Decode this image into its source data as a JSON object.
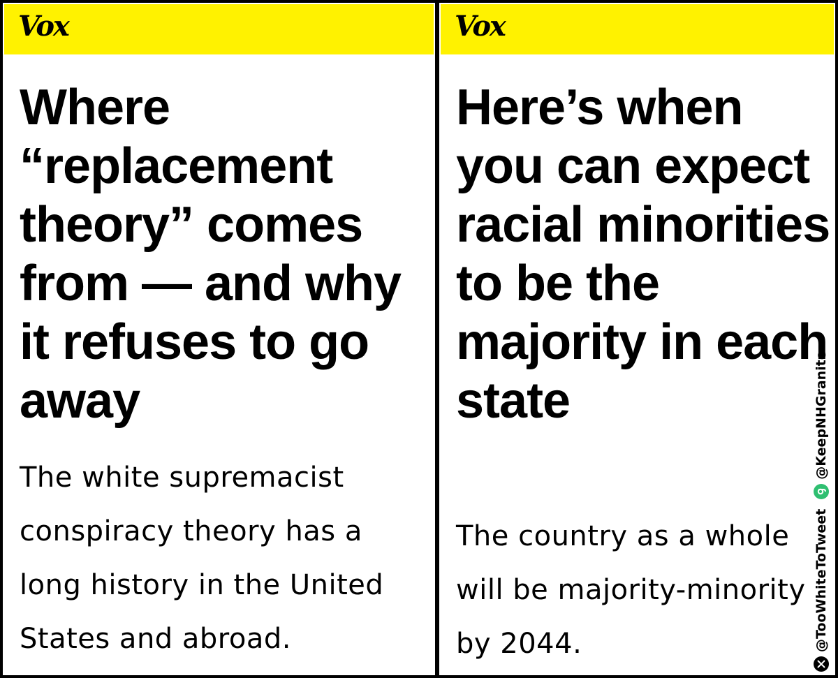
{
  "left_card": {
    "brand": "Vox",
    "headline": "Where “replacement theory” comes from — and why it refuses to go away",
    "dek": "The white supremacist conspiracy theory has a long history in the United States and abroad."
  },
  "right_card": {
    "brand": "Vox",
    "headline": "Here’s when you can expect racial minorities to be the majority in each state",
    "dek": "The country as a whole will be majority-minority by 2044."
  },
  "watermark": {
    "x_handle": "@TooWhiteToTweet",
    "gab_handle": "@KeepNHGranite",
    "icons": [
      "x-logo-icon",
      "gab-logo-icon"
    ],
    "colors": {
      "brand_bar": "#fff200",
      "gab": "#2fbf71"
    }
  }
}
